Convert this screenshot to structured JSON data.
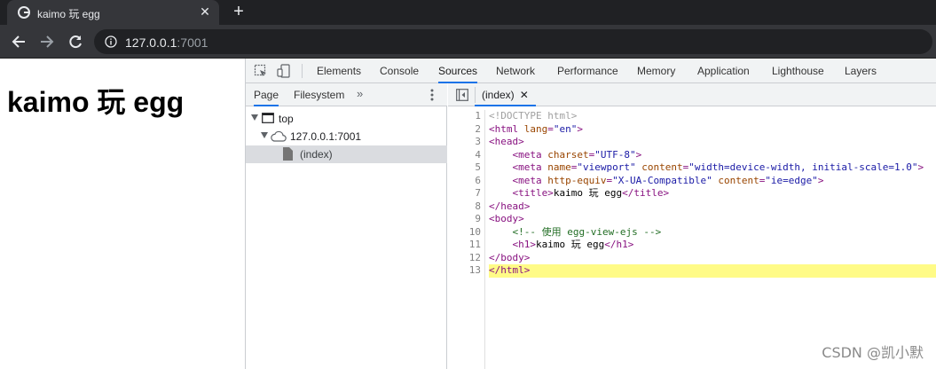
{
  "browser": {
    "tab_title": "kaimo 玩 egg",
    "url_host": "127.0.0.1",
    "url_port": ":7001"
  },
  "page": {
    "heading": "kaimo 玩 egg"
  },
  "devtools": {
    "tabs": [
      "Elements",
      "Console",
      "Sources",
      "Network",
      "Performance",
      "Memory",
      "Application",
      "Lighthouse",
      "Layers"
    ],
    "active_tab": "Sources",
    "navigator": {
      "tabs": [
        "Page",
        "Filesystem"
      ],
      "more": "»",
      "tree": [
        "top",
        "127.0.0.1:7001",
        "(index)"
      ]
    },
    "editor": {
      "file_tab": "(index)",
      "line_numbers": [
        "1",
        "2",
        "3",
        "4",
        "5",
        "6",
        "7",
        "8",
        "9",
        "10",
        "11",
        "12",
        "13"
      ],
      "lines": [
        "<!DOCTYPE html>",
        "<html lang=\"en\">",
        "<head>",
        "    <meta charset=\"UTF-8\">",
        "    <meta name=\"viewport\" content=\"width=device-width, initial-scale=1.0\">",
        "    <meta http-equiv=\"X-UA-Compatible\" content=\"ie=edge\">",
        "    <title>kaimo 玩 egg</title>",
        "</head>",
        "<body>",
        "    <!-- 使用 egg-view-ejs -->",
        "    <h1>kaimo 玩 egg</h1>",
        "</body>",
        "</html>"
      ]
    }
  },
  "watermark": "CSDN @凯小默"
}
